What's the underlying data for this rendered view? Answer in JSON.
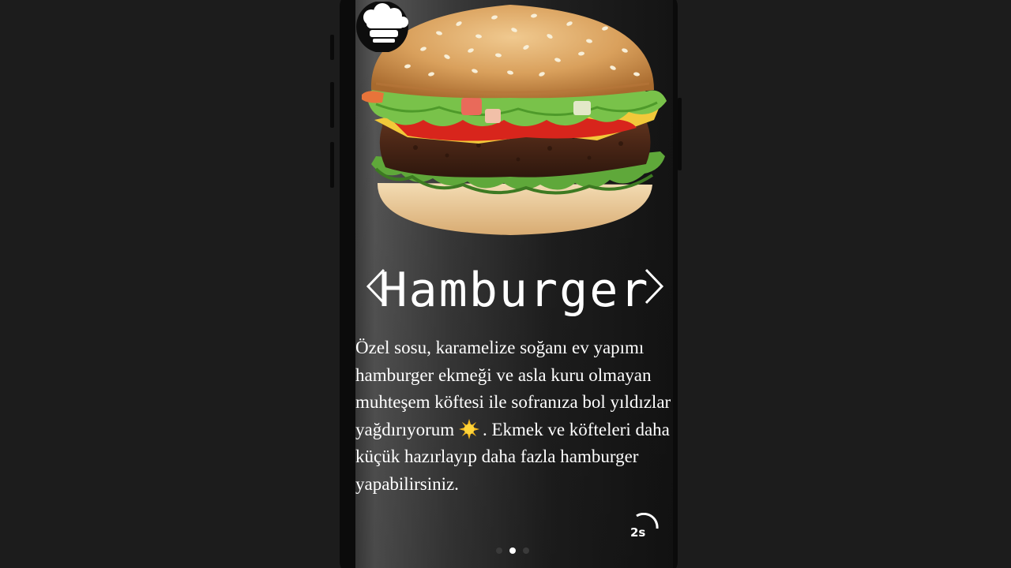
{
  "slide": {
    "title": "Hamburger",
    "description_part1": "Özel sosu, karamelize soğanı ev yapımı hamburger ekmeği ve asla kuru olmayan muhteşem köftesi ile sofranıza bol yıldızlar yağdırıyorum",
    "description_part2": ". Ekmek ve köfteleri daha küçük hazırlayıp daha fazla hamburger yapabilirsiniz.",
    "image_icon": "hamburger-image",
    "emoji_icon": "sun-emoji-icon"
  },
  "timer": {
    "label": "2s",
    "progress": 0.25
  },
  "pagination": {
    "count": 3,
    "active_index": 1
  },
  "colors": {
    "text": "#ffffff",
    "active_dot": "#ffffff",
    "inactive_dot": "#3a3a3a",
    "page_background": "#1c1c1c"
  }
}
